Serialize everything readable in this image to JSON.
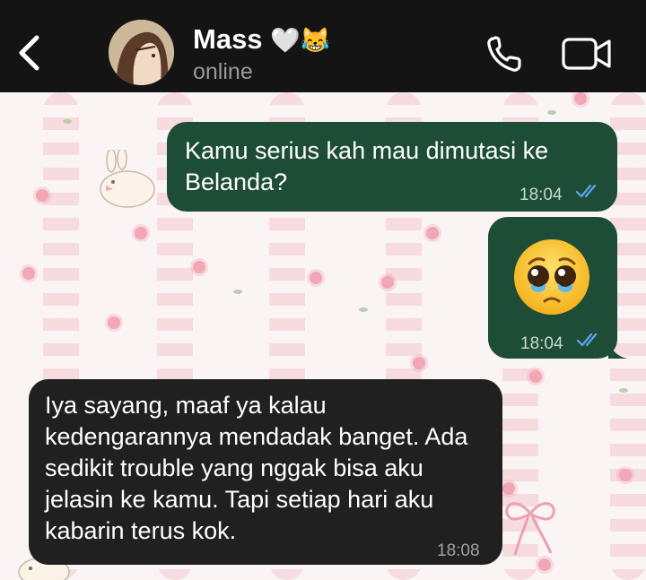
{
  "header": {
    "contact_name": "Mass",
    "name_emojis": "🤍😹",
    "status": "online"
  },
  "icons": {
    "back": "chevron-left-icon",
    "call": "phone-icon",
    "video": "video-camera-icon",
    "read": "double-check-icon"
  },
  "colors": {
    "header_bg": "#141414",
    "outgoing_bubble": "#1d4d36",
    "incoming_bubble": "#202020",
    "read_ticks": "#5aa7e8"
  },
  "messages": [
    {
      "direction": "outgoing",
      "text": "Kamu serius kah mau dimutasi ke Belanda?",
      "time": "18:04",
      "status": "read"
    },
    {
      "direction": "outgoing",
      "text": "🥹",
      "time": "18:04",
      "status": "read"
    },
    {
      "direction": "incoming",
      "text": "Iya sayang, maaf ya kalau kedengarannya mendadak banget. Ada sedikit trouble yang nggak bisa aku jelasin ke kamu. Tapi setiap hari aku kabarin terus kok.",
      "time": "18:08"
    }
  ]
}
